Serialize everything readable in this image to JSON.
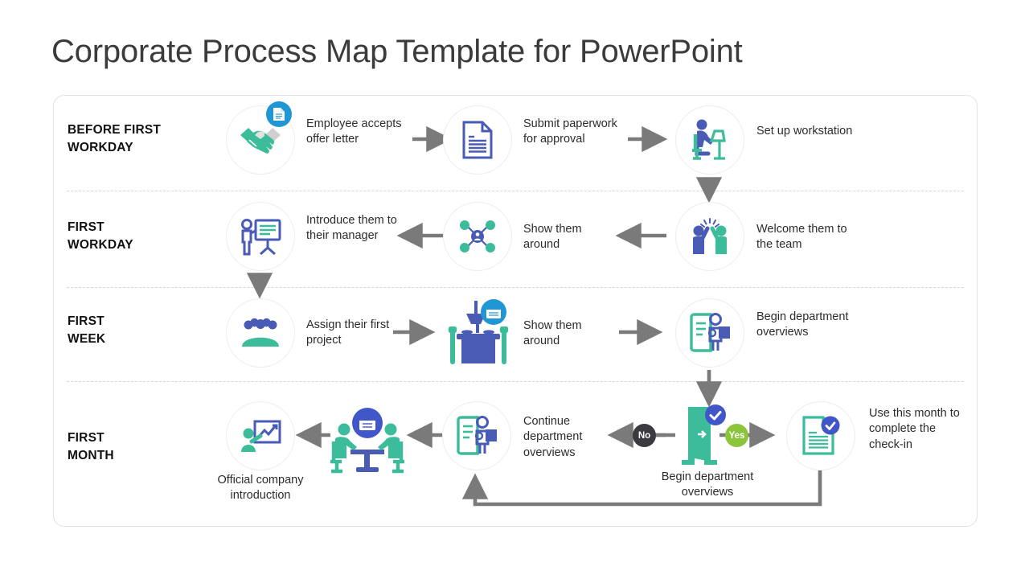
{
  "page": {
    "title": "Corporate Process Map Template for PowerPoint",
    "background": "#ffffff"
  },
  "colors": {
    "green": "#3cbc9a",
    "blue": "#4a5bb5",
    "indigo": "#4156c8",
    "cyan": "#2196d4",
    "gray_icon": "#cfcfcf",
    "arrow": "#7a7a7a",
    "yes": "#8cc43c",
    "no": "#3a3a40",
    "text": "#2c2c2c",
    "title": "#3b3b3b",
    "card_border": "#e2e2e4",
    "circle_border": "#ededef",
    "divider": "#d6d6d8"
  },
  "rows": [
    {
      "label": "BEFORE FIRST\nWORKDAY",
      "label_lines": [
        "BEFORE FIRST",
        "WORKDAY"
      ],
      "flow_direction": "left-to-right",
      "steps": [
        {
          "icon": "handshake-icon",
          "badge": "document-badge-icon",
          "caption": "Employee accepts offer letter"
        },
        {
          "icon": "document-icon",
          "badge": null,
          "caption": "Submit paperwork for approval"
        },
        {
          "icon": "workstation-icon",
          "badge": null,
          "caption": "Set up workstation"
        }
      ]
    },
    {
      "label_lines": [
        "FIRST",
        "WORKDAY"
      ],
      "flow_direction": "right-to-left",
      "steps": [
        {
          "icon": "presenter-board-icon",
          "badge": null,
          "caption": "Introduce them to their manager"
        },
        {
          "icon": "network-person-icon",
          "badge": null,
          "caption": "Show them around"
        },
        {
          "icon": "high-five-icon",
          "badge": null,
          "caption": "Welcome them to the team"
        }
      ]
    },
    {
      "label_lines": [
        "FIRST",
        "WEEK"
      ],
      "flow_direction": "left-to-right",
      "steps": [
        {
          "icon": "team-group-icon",
          "badge": null,
          "caption": "Assign their first project"
        },
        {
          "icon": "dinner-table-icon",
          "badge": "calendar-badge-icon",
          "caption": "Show them around"
        },
        {
          "icon": "person-clipboard-icon",
          "badge": null,
          "caption": "Begin department overviews"
        }
      ]
    },
    {
      "label_lines": [
        "FIRST",
        "MONTH"
      ],
      "flow_direction": "right-to-left",
      "steps": [
        {
          "icon": "presentation-chart-icon",
          "badge": null,
          "caption": "Official company introduction"
        },
        {
          "icon": "meeting-table-icon",
          "badge": "calendar-badge-icon",
          "caption": ""
        },
        {
          "icon": "clipboard-person-icon",
          "badge": null,
          "caption": "Continue department overviews"
        },
        {
          "icon": "door-icon",
          "badge": "check-badge-icon",
          "caption": "Begin department overviews"
        },
        {
          "icon": "document-check-icon",
          "badge": "check-badge-icon",
          "caption": "Use this month to complete the check-in"
        }
      ],
      "decision": {
        "no_label": "No",
        "yes_label": "Yes"
      }
    }
  ],
  "captions": {
    "r1c1": "Employee accepts offer letter",
    "r1c2": "Submit paperwork for approval",
    "r1c3": "Set up workstation",
    "r2c1": "Introduce them to their manager",
    "r2c2": "Show them around",
    "r2c3": "Welcome them to the team",
    "r3c1": "Assign their first project",
    "r3c2": "Show them around",
    "r3c3": "Begin department overviews",
    "r4c1": "Official company introduction",
    "r4c3": "Continue department overviews",
    "r4c4": "Begin department overviews",
    "r4c5": "Use this month to complete the check-in"
  },
  "labels": {
    "row1_l1": "BEFORE FIRST",
    "row1_l2": "WORKDAY",
    "row2_l1": "FIRST",
    "row2_l2": "WORKDAY",
    "row3_l1": "FIRST",
    "row3_l2": "WEEK",
    "row4_l1": "FIRST",
    "row4_l2": "MONTH"
  },
  "decision": {
    "no": "No",
    "yes": "Yes"
  }
}
